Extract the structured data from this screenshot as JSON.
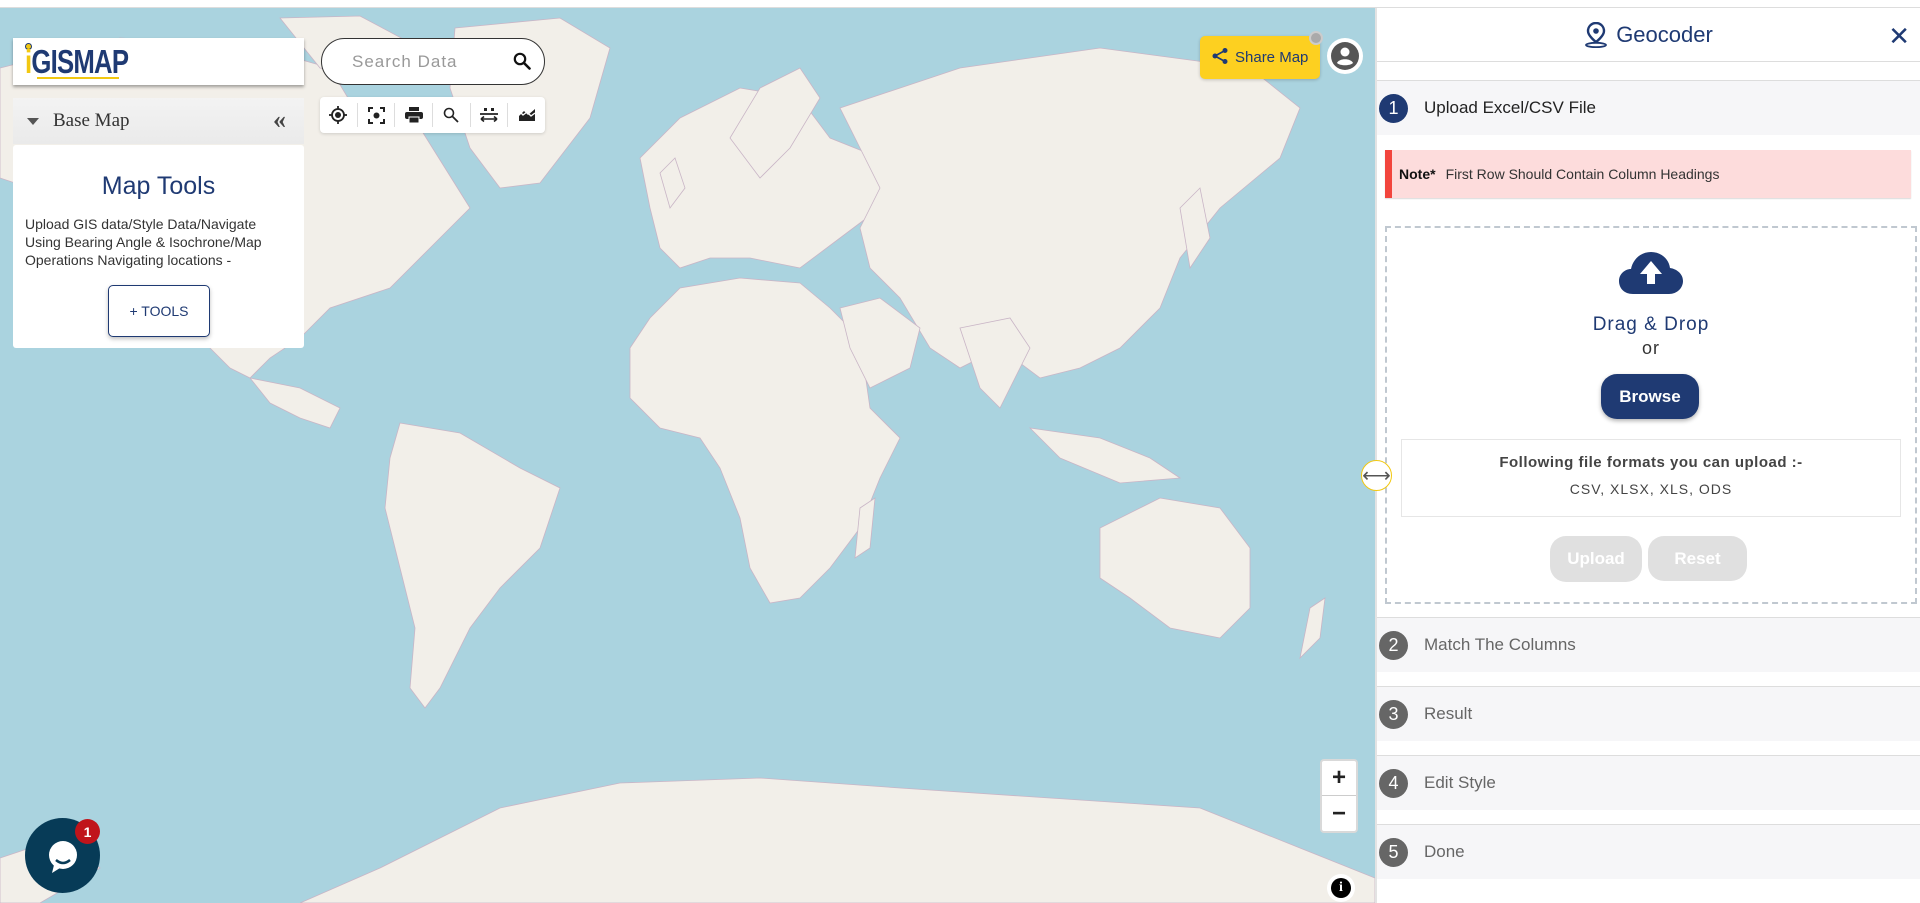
{
  "app": {
    "logo_text": "GISMAP",
    "brand_colors": {
      "primary": "#1f3a73",
      "accent": "#f2c811",
      "ocean": "#aad3df",
      "land": "#f2efe9"
    }
  },
  "left_panel": {
    "basemap_label": "Base Map",
    "collapse_icon": "double-chevron-left-icon",
    "tools_card": {
      "title": "Map Tools",
      "description": "Upload GIS data/Style Data/Navigate Using Bearing Angle & Isochrone/Map Operations Navigating locations -",
      "button_label": "+ TOOLS"
    }
  },
  "search": {
    "placeholder": "Search Data",
    "value": ""
  },
  "toolbar": {
    "items": [
      {
        "icon": "locate-icon",
        "title": "My Location"
      },
      {
        "icon": "focus-icon",
        "title": "Focus"
      },
      {
        "icon": "print-icon",
        "title": "Print"
      },
      {
        "icon": "zoom-search-icon",
        "title": "Search"
      },
      {
        "icon": "measure-icon",
        "title": "Measure"
      },
      {
        "icon": "elevation-icon",
        "title": "Elevation"
      }
    ]
  },
  "header_actions": {
    "share_label": "Share Map",
    "share_icon": "share-icon",
    "user_icon": "user-account-icon"
  },
  "map_controls": {
    "zoom_in": "+",
    "zoom_out": "−",
    "info": "i"
  },
  "chat": {
    "badge_count": "1"
  },
  "geocoder": {
    "title": "Geocoder",
    "close_label": "✕",
    "steps": [
      {
        "number": "1",
        "label": "Upload Excel/CSV File",
        "active": true
      },
      {
        "number": "2",
        "label": "Match The Columns",
        "active": false
      },
      {
        "number": "3",
        "label": "Result",
        "active": false
      },
      {
        "number": "4",
        "label": "Edit Style",
        "active": false
      },
      {
        "number": "5",
        "label": "Done",
        "active": false
      }
    ],
    "note_label": "Note*",
    "note_text": "First Row Should Contain Column Headings",
    "drag_text": "Drag & Drop",
    "or_text": "or",
    "browse_label": "Browse",
    "formats_title": "Following file formats you can upload :-",
    "formats_list": "CSV, XLSX, XLS, ODS",
    "upload_label": "Upload",
    "reset_label": "Reset"
  }
}
